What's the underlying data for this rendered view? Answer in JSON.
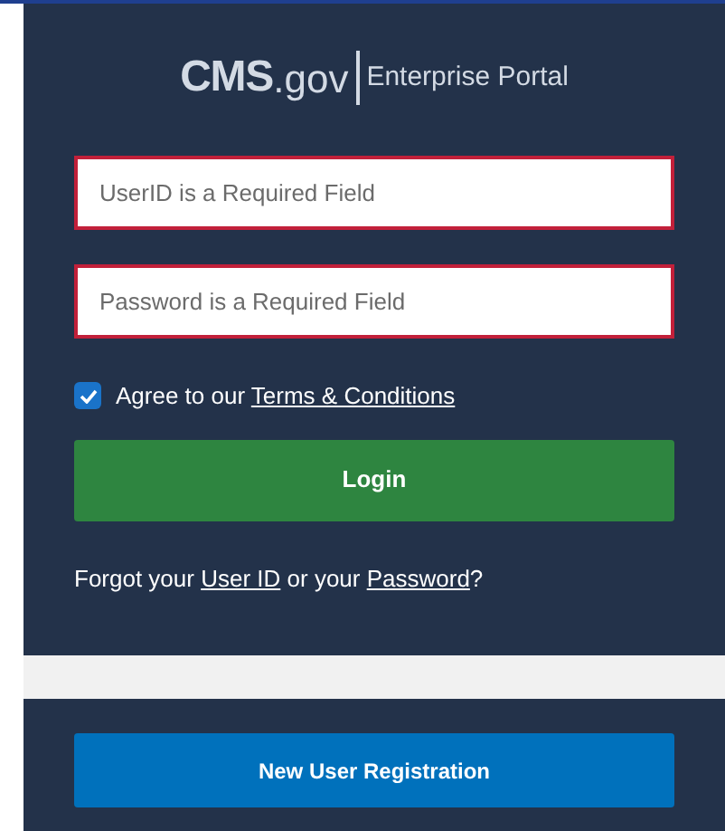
{
  "logo": {
    "brand": "CMS",
    "suffix": ".gov",
    "product": "Enterprise Portal"
  },
  "fields": [
    {
      "placeholder": "UserID is a Required Field",
      "error": true
    },
    {
      "placeholder": "Password is a Required Field",
      "error": true
    }
  ],
  "agree": {
    "checked": true,
    "text": "Agree to our ",
    "link": "Terms & Conditions"
  },
  "login_button": "Login",
  "forgot": {
    "text_1": "Forgot your ",
    "link_1": "User ID",
    "text_2": " or your ",
    "link_2": "Password",
    "text_3": "?"
  },
  "registration_button": "New User Registration"
}
